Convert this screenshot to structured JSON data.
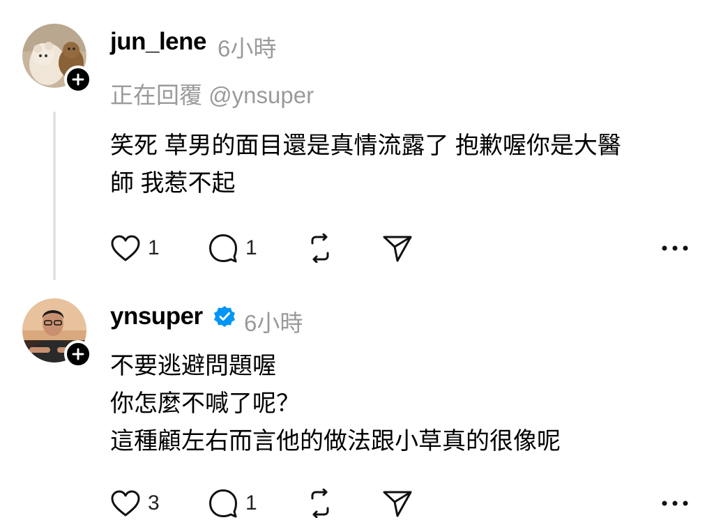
{
  "posts": [
    {
      "username": "jun_lene",
      "time": "6小時",
      "replying_to": "正在回覆 @ynsuper",
      "text": "笑死 草男的面目還是真情流露了 抱歉喔你是大醫\n師 我惹不起",
      "likes": "1",
      "replies": "1",
      "verified": false
    },
    {
      "username": "ynsuper",
      "time": "6小時",
      "text": "不要逃避問題喔\n你怎麼不喊了呢？\n這種顧左右而言他的做法跟小草真的很像呢",
      "likes": "3",
      "replies": "1",
      "verified": true
    }
  ],
  "icons": {
    "like": "heart-icon",
    "reply": "comment-icon",
    "repost": "repost-icon",
    "share": "send-icon",
    "more": "more-icon",
    "follow": "plus-icon",
    "verified": "verified-badge-icon"
  },
  "colors": {
    "text": "#000000",
    "muted": "#9a9a9a",
    "verified": "#0095f6",
    "thread_line": "#e3e3e3"
  }
}
